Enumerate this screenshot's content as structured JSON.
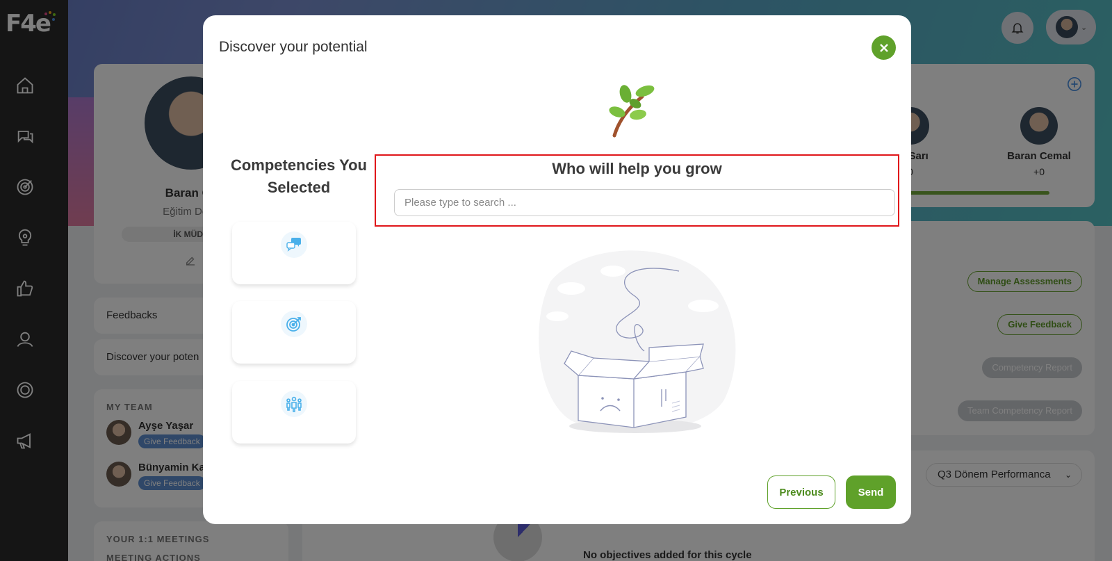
{
  "app": {
    "logo_text": "F4e"
  },
  "sidebar": {
    "items": [
      {
        "icon": "home-icon"
      },
      {
        "icon": "chat-icon"
      },
      {
        "icon": "target-icon"
      },
      {
        "icon": "lightbulb-icon"
      },
      {
        "icon": "thumbs-up-icon"
      },
      {
        "icon": "person-icon"
      },
      {
        "icon": "settings-icon"
      },
      {
        "icon": "megaphone-icon"
      }
    ]
  },
  "profile": {
    "name": "Baran Ce",
    "department": "Eğitim Depa",
    "role": "İK MÜDÜ"
  },
  "menu": {
    "feedbacks": "Feedbacks",
    "discover": "Discover your poten"
  },
  "team": {
    "title": "MY TEAM",
    "members": [
      {
        "name": "Ayşe Yaşar",
        "action": "Give Feedback"
      },
      {
        "name": "Bünyamin Ka",
        "action": "Give Feedback"
      }
    ]
  },
  "meetings": {
    "title": "YOUR 1:1 MEETINGS",
    "subtitle": "MEETING ACTIONS"
  },
  "people_card": {
    "people": [
      {
        "name": "rat Sarı",
        "score": "0"
      },
      {
        "name": "Baran Cemal",
        "score": "+0"
      }
    ]
  },
  "actions": {
    "manage": "Manage Assessments",
    "give_feedback": "Give Feedback",
    "competency_report": "Competency Report",
    "team_report": "Team Competency Report"
  },
  "bottom": {
    "cycle": "Q3 Dönem Performanca",
    "no_objectives": "No objectives added for this cycle"
  },
  "modal": {
    "title": "Discover your potential",
    "competencies_title": "Competencies You Selected",
    "competency_icons": [
      "chat-bubbles-icon",
      "target-arrow-icon",
      "team-icon"
    ],
    "grow_title": "Who will help you grow",
    "search_placeholder": "Please type to search ...",
    "search_value": "",
    "previous": "Previous",
    "send": "Send"
  },
  "colors": {
    "accent": "#5fa12a",
    "highlight": "#e0161a",
    "sidebar": "#2b2b2b"
  }
}
